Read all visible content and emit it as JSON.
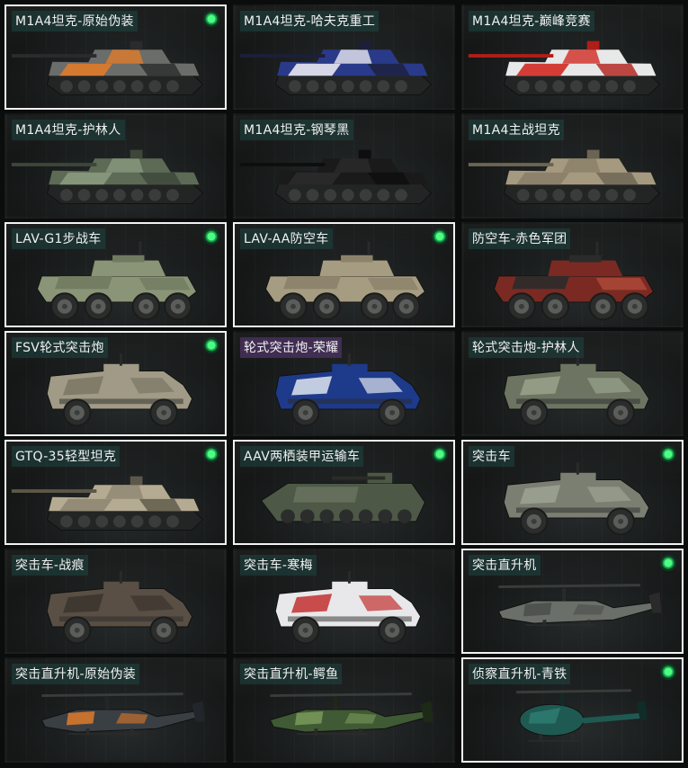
{
  "colors": {
    "selected_border": "#f2f2f2",
    "status_dot": "#33e06d",
    "label_bg": "#1e4642",
    "label_bg_alt": "#4a3260"
  },
  "cards": [
    {
      "name": "M1A4坦克-原始伪装",
      "kind": "tank",
      "selected": true,
      "dot": true,
      "skin": [
        "#6a6d6a",
        "#e07a2a",
        "#2a2b2c"
      ]
    },
    {
      "name": "M1A4坦克-哈夫克重工",
      "kind": "tank",
      "selected": false,
      "dot": false,
      "skin": [
        "#2a3a8a",
        "#e8e8f0",
        "#1c1f3a"
      ]
    },
    {
      "name": "M1A4坦克-巅峰竞赛",
      "kind": "tank",
      "selected": false,
      "dot": false,
      "skin": [
        "#e8e8e8",
        "#d02a22",
        "#b01e18"
      ]
    },
    {
      "name": "M1A4坦克-护林人",
      "kind": "tank",
      "selected": false,
      "dot": false,
      "skin": [
        "#5d6a55",
        "#8a9a7e",
        "#3d4639"
      ]
    },
    {
      "name": "M1A4坦克-钢琴黑",
      "kind": "tank",
      "selected": false,
      "dot": false,
      "skin": [
        "#1a1a1a",
        "#2b2b2b",
        "#0e0e0e"
      ]
    },
    {
      "name": "M1A4主战坦克",
      "kind": "tank",
      "selected": false,
      "dot": false,
      "skin": [
        "#a59a80",
        "#8a8068",
        "#6c6452"
      ]
    },
    {
      "name": "LAV-G1步战车",
      "kind": "apc",
      "selected": true,
      "dot": true,
      "skin": [
        "#8a9476",
        "#6f7a60",
        "#2a2c2a"
      ]
    },
    {
      "name": "LAV-AA防空车",
      "kind": "apc",
      "selected": true,
      "dot": true,
      "skin": [
        "#a69c82",
        "#8c826a",
        "#2a2c2a"
      ]
    },
    {
      "name": "防空车-赤色军团",
      "kind": "apc",
      "selected": false,
      "dot": false,
      "skin": [
        "#7a2a22",
        "#2b2b2b",
        "#b04a3a"
      ]
    },
    {
      "name": "FSV轮式突击炮",
      "kind": "armored",
      "selected": true,
      "dot": true,
      "skin": [
        "#a09a86",
        "#7b7664",
        "#2a2a2a"
      ]
    },
    {
      "name": "轮式突击炮-荣耀",
      "kind": "armored",
      "selected": false,
      "dot": false,
      "skin": [
        "#1e3a8a",
        "#dfe6ee",
        "#2a2a2a"
      ]
    },
    {
      "name": "轮式突击炮-护林人",
      "kind": "armored",
      "selected": false,
      "dot": false,
      "skin": [
        "#6d7562",
        "#9aa28c",
        "#2a2a2a"
      ]
    },
    {
      "name": "GTQ-35轻型坦克",
      "kind": "tank",
      "selected": true,
      "dot": true,
      "skin": [
        "#b4ab92",
        "#8f8772",
        "#5c5748"
      ]
    },
    {
      "name": "AAV两栖装甲运输车",
      "kind": "amphib",
      "selected": true,
      "dot": true,
      "skin": [
        "#4e5846",
        "#6a7460",
        "#2a2c28"
      ]
    },
    {
      "name": "突击车",
      "kind": "armored",
      "selected": true,
      "dot": true,
      "skin": [
        "#7a7f72",
        "#9ea393",
        "#2a2a2a"
      ]
    },
    {
      "name": "突击车-战痕",
      "kind": "armored",
      "selected": false,
      "dot": false,
      "skin": [
        "#5a4f44",
        "#3a342e",
        "#2a2a2a"
      ]
    },
    {
      "name": "突击车-寒梅",
      "kind": "armored",
      "selected": false,
      "dot": false,
      "skin": [
        "#e8e8ea",
        "#c23030",
        "#2a2a2a"
      ]
    },
    {
      "name": "突击直升机",
      "kind": "heli",
      "selected": true,
      "dot": true,
      "skin": [
        "#6b6f6a",
        "#4a4d49",
        "#2a2a2a"
      ]
    },
    {
      "name": "突击直升机-原始伪装",
      "kind": "heli",
      "selected": false,
      "dot": false,
      "skin": [
        "#3a3f44",
        "#e07a2a",
        "#22262a"
      ]
    },
    {
      "name": "突击直升机-鳄鱼",
      "kind": "heli",
      "selected": false,
      "dot": false,
      "skin": [
        "#3f5a34",
        "#7a9a5a",
        "#1e2a18"
      ]
    },
    {
      "name": "侦察直升机-青铁",
      "kind": "scout",
      "selected": true,
      "dot": true,
      "skin": [
        "#1f5a52",
        "#2e7a70",
        "#0f2c28"
      ]
    }
  ]
}
